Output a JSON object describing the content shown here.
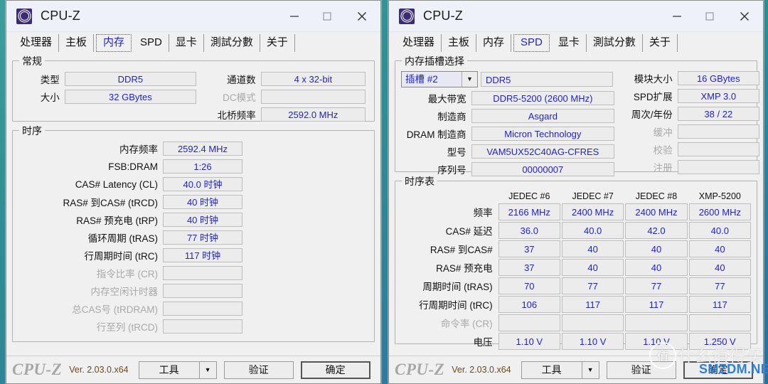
{
  "window_title": "CPU-Z",
  "caption": {
    "minimize": "–",
    "maximize": "□",
    "close": "✕"
  },
  "tabs": [
    "处理器",
    "主板",
    "内存",
    "SPD",
    "显卡",
    "測試分數",
    "关于"
  ],
  "memory_window": {
    "selected_tab": "内存",
    "general": {
      "legend": "常规",
      "type_label": "类型",
      "type_value": "DDR5",
      "size_label": "大小",
      "size_value": "32 GBytes",
      "channels_label": "通道数",
      "channels_value": "4 x 32-bit",
      "dc_mode_label": "DC模式",
      "dc_mode_value": "",
      "nb_freq_label": "北桥频率",
      "nb_freq_value": "2592.0 MHz"
    },
    "timings": {
      "legend": "时序",
      "rows": [
        {
          "label": "内存频率",
          "value": "2592.4 MHz",
          "dim": false
        },
        {
          "label": "FSB:DRAM",
          "value": "1:26",
          "dim": false
        },
        {
          "label": "CAS# Latency (CL)",
          "value": "40.0 时钟",
          "dim": false
        },
        {
          "label": "RAS# 到CAS# (tRCD)",
          "value": "40 时钟",
          "dim": false
        },
        {
          "label": "RAS# 预充电 (tRP)",
          "value": "40 时钟",
          "dim": false
        },
        {
          "label": "循环周期 (tRAS)",
          "value": "77 时钟",
          "dim": false
        },
        {
          "label": "行周期时间 (tRC)",
          "value": "117 时钟",
          "dim": false
        },
        {
          "label": "指令比率 (CR)",
          "value": "",
          "dim": true
        },
        {
          "label": "内存空闲计时器",
          "value": "",
          "dim": true
        },
        {
          "label": "总CAS号 (tRDRAM)",
          "value": "",
          "dim": true
        },
        {
          "label": "行至列 (tRCD)",
          "value": "",
          "dim": true
        }
      ]
    }
  },
  "spd_window": {
    "selected_tab": "SPD",
    "slot_selection": {
      "legend": "内存插槽选择",
      "slot_value": "插槽 #2",
      "slot_arrow": "▼",
      "module_type": "DDR5",
      "left_rows": [
        {
          "label": "最大带宽",
          "value": "DDR5-5200 (2600 MHz)",
          "dim": false
        },
        {
          "label": "制造商",
          "value": "Asgard",
          "dim": false
        },
        {
          "label": "DRAM 制造商",
          "value": "Micron Technology",
          "dim": false
        },
        {
          "label": "型号",
          "value": "VAM5UX52C40AG-CFRES",
          "dim": false
        },
        {
          "label": "序列号",
          "value": "00000007",
          "dim": false
        }
      ],
      "right_rows": [
        {
          "label": "模块大小",
          "value": "16 GBytes",
          "dim": false
        },
        {
          "label": "SPD扩展",
          "value": "XMP 3.0",
          "dim": false
        },
        {
          "label": "周次/年份",
          "value": "38 / 22",
          "dim": false
        },
        {
          "label": "缓冲",
          "value": "",
          "dim": true
        },
        {
          "label": "校验",
          "value": "",
          "dim": true
        },
        {
          "label": "注册",
          "value": "",
          "dim": true
        }
      ]
    },
    "timing_table": {
      "legend": "时序表",
      "columns": [
        "JEDEC #6",
        "JEDEC #7",
        "JEDEC #8",
        "XMP-5200"
      ],
      "rows": [
        {
          "label": "频率",
          "dim": false,
          "values": [
            "2166 MHz",
            "2400 MHz",
            "2400 MHz",
            "2600 MHz"
          ]
        },
        {
          "label": "CAS# 延迟",
          "dim": false,
          "values": [
            "36.0",
            "40.0",
            "42.0",
            "40.0"
          ]
        },
        {
          "label": "RAS# 到CAS#",
          "dim": false,
          "values": [
            "37",
            "40",
            "40",
            "40"
          ]
        },
        {
          "label": "RAS# 预充电",
          "dim": false,
          "values": [
            "37",
            "40",
            "40",
            "40"
          ]
        },
        {
          "label": "周期时间 (tRAS)",
          "dim": false,
          "values": [
            "70",
            "77",
            "77",
            "77"
          ]
        },
        {
          "label": "行周期时间 (tRC)",
          "dim": false,
          "values": [
            "106",
            "117",
            "117",
            "117"
          ]
        },
        {
          "label": "命令率 (CR)",
          "dim": true,
          "values": [
            "",
            "",
            "",
            ""
          ]
        },
        {
          "label": "电压",
          "dim": false,
          "values": [
            "1.10 V",
            "1.10 V",
            "1.10 V",
            "1.250 V"
          ]
        }
      ]
    }
  },
  "footer": {
    "brand": "CPU-Z",
    "version": "Ver. 2.03.0.x64",
    "tools_label": "工具",
    "tools_arrow": "▼",
    "validate_label": "验证",
    "ok_label": "确定"
  },
  "watermark": {
    "logo_char": "值",
    "chinese": "什么值得买",
    "site": "SMZDM.NET",
    "site_color": "#2f7fd6"
  }
}
